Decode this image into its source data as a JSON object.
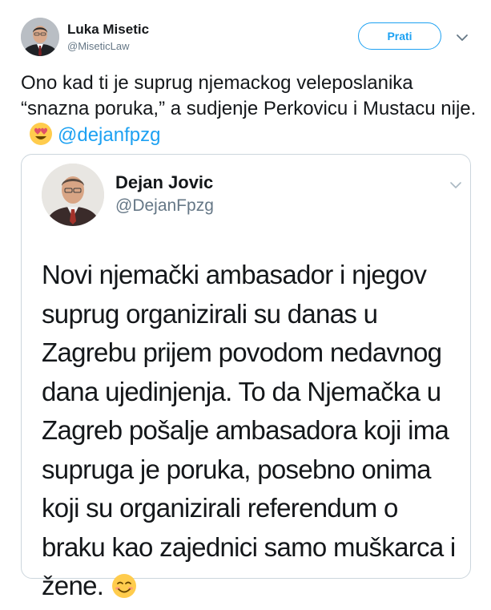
{
  "tweet": {
    "author_name": "Luka Misetic",
    "author_handle": "@MiseticLaw",
    "follow_label": "Prati",
    "text": "Ono kad ti je suprug njemackog veleposlanika “snazna poruka,” a sudjenje Perkovicu i Mustacu nije.",
    "emoji": "smiling-face-with-heart-eyes-emoji",
    "mention": "@dejanfpzg"
  },
  "quoted_tweet": {
    "author_name": "Dejan Jovic",
    "author_handle": "@DejanFpzg",
    "text": "Novi njemački ambasador i njegov suprug organizirali su danas u Zagrebu prijem povodom nedavnog dana ujedinjenja. To da Njemačka u Zagreb pošalje ambasadora koji ima supruga je poruka, posebno onima koji su organizirali referendum o braku kao zajednici samo muškarca i žene.",
    "emoji": "smiling-face-emoji"
  },
  "colors": {
    "accent": "#1da1f2",
    "text": "#14171a",
    "muted": "#657786",
    "border": "#ccd6dd"
  },
  "icons": {
    "menu": "chevron-down-icon"
  }
}
